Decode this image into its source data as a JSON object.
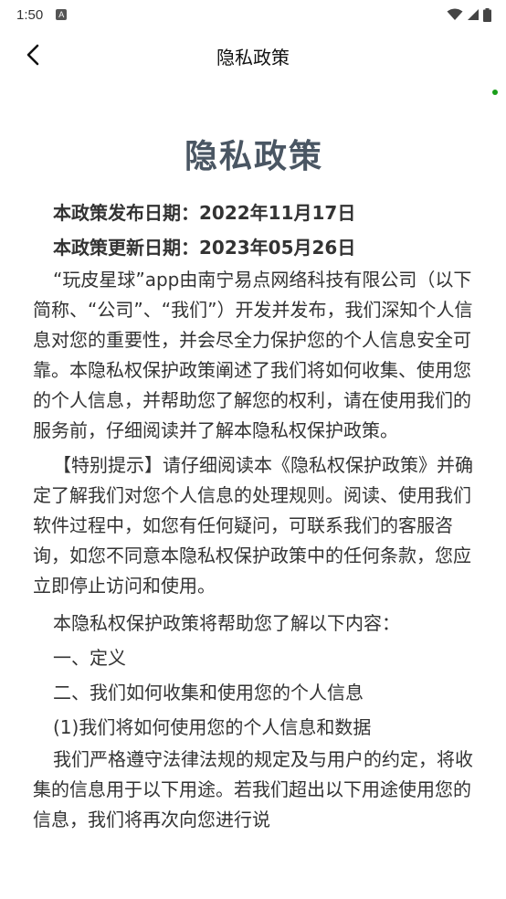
{
  "status_bar": {
    "time": "1:50",
    "notification_icon": "A",
    "icons": [
      "wifi-icon",
      "signal-icon",
      "battery-icon"
    ]
  },
  "app_bar": {
    "title": "隐私政策",
    "back_icon": "chevron-left-icon"
  },
  "document": {
    "title": "隐私政策",
    "publish_date": "本政策发布日期：2022年11月17日",
    "update_date": "本政策更新日期：2023年05月26日",
    "paragraphs": [
      "“玩皮星球”app由南宁易点网络科技有限公司（以下简称、“公司”、“我们”）开发并发布，我们深知个人信息对您的重要性，并会尽全力保护您的个人信息安全可靠。本隐私权保护政策阐述了我们将如何收集、使用您的个人信息，并帮助您了解您的权利，请在使用我们的服务前，仔细阅读并了解本隐私权保护政策。",
      "【特别提示】请仔细阅读本《隐私权保护政策》并确定了解我们对您个人信息的处理规则。阅读、使用我们软件过程中，如您有任何疑问，可联系我们的客服咨询，如您不同意本隐私权保护政策中的任何条款，您应立即停止访问和使用。"
    ],
    "intro": "本隐私权保护政策将帮助您了解以下内容：",
    "items": [
      "一、定义",
      "二、我们如何收集和使用您的个人信息",
      "(1)我们将如何使用您的个人信息和数据"
    ],
    "last_paragraph": "我们严格遵守法律法规的规定及与用户的约定，将收集的信息用于以下用途。若我们超出以下用途使用您的信息，我们将再次向您进行说"
  },
  "colors": {
    "title": "#4a5663",
    "body_text": "#333333",
    "indicator_dot": "#1a9e1a"
  }
}
